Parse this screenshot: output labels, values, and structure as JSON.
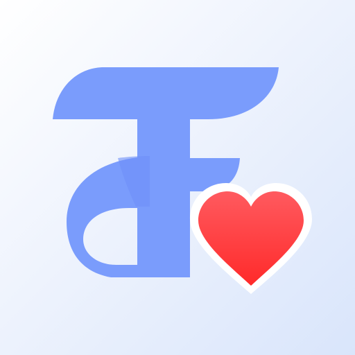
{
  "icon": {
    "logo_mark": "stylized-letter-f-logo-icon",
    "badge": "heart-icon"
  },
  "colors": {
    "background_light": "#ffffff",
    "background_dark": "#d9e5fb",
    "logo_blue": "#7a9cfc",
    "logo_blue_shade": "#6e90f8",
    "heart_top": "#ff5a5f",
    "heart_bottom": "#ff2a2a"
  }
}
